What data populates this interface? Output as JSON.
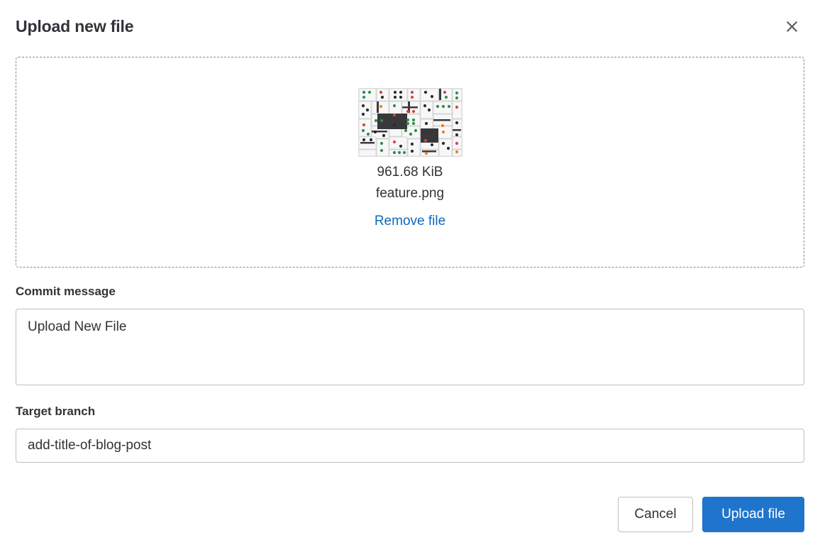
{
  "dialog": {
    "title": "Upload new file",
    "close_icon": "close-icon"
  },
  "dropzone": {
    "preview": {
      "image_description": "dominoes-thumbnail",
      "file_size": "961.68 KiB",
      "file_name": "feature.png",
      "remove_label": "Remove file"
    }
  },
  "form": {
    "commit": {
      "label": "Commit message",
      "value": "Upload New File",
      "placeholder": ""
    },
    "branch": {
      "label": "Target branch",
      "value": "add-title-of-blog-post",
      "placeholder": ""
    }
  },
  "footer": {
    "cancel_label": "Cancel",
    "upload_label": "Upload file"
  },
  "colors": {
    "primary": "#1f75cb",
    "link": "#1068bf",
    "text": "#333238",
    "border": "#bfbfc3",
    "dashed_border": "#89888d"
  }
}
